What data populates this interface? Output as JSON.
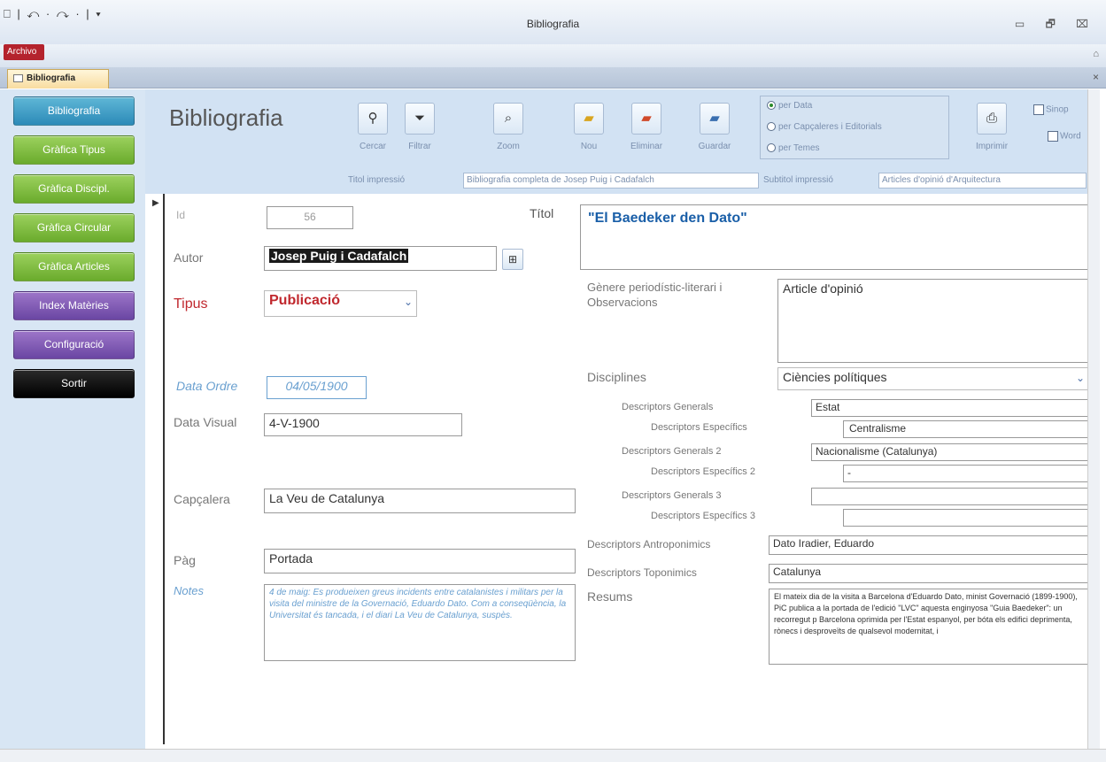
{
  "window": {
    "title": "Bibliografia",
    "qat": "⎕ | ↶ · ↷ · | ▾",
    "controls": "▭ 🗗 ⌧"
  },
  "ribbon": {
    "file_tab": "Archivo",
    "minimize": "⌂"
  },
  "doc_tab": {
    "label": "Bibliografia",
    "close": "×"
  },
  "nav": {
    "items": [
      {
        "label": "Bibliografia"
      },
      {
        "label": "Gràfica Tipus"
      },
      {
        "label": "Gràfica Discipl."
      },
      {
        "label": "Gràfica Circular"
      },
      {
        "label": "Gràfica Articles"
      },
      {
        "label": "Index Matèries"
      },
      {
        "label": "Configuració"
      },
      {
        "label": "Sortir"
      }
    ]
  },
  "header": {
    "title": "Bibliografia",
    "buttons": {
      "cercar": "Cercar",
      "filtrar": "Filtrar",
      "zoom": "Zoom",
      "nou": "Nou",
      "eliminar": "Eliminar",
      "guardar": "Guardar",
      "imprimir": "Imprimir"
    },
    "radios": {
      "per_data": "per Data",
      "per_capcaleres": "per Capçaleres i Editorials",
      "per_temes": "per Temes"
    },
    "checks": {
      "sinopsi": "Sinop",
      "word": "Word"
    },
    "titol_imp_label": "Titol impressió",
    "titol_imp_value": "Bibliografia completa de Josep Puig i Cadafalch",
    "subtitol_imp_label": "Subtitol impressió",
    "subtitol_imp_value": "Articles d'opinió d'Arquitectura"
  },
  "record": {
    "id_label": "Id",
    "id_value": "56",
    "titol_label": "Títol",
    "titol_value": "\"El Baedeker den Dato\"",
    "autor_label": "Autor",
    "autor_value": "Josep Puig i Cadafalch",
    "tipus_label": "Tipus",
    "tipus_value": "Publicació",
    "genere_label": "Gènere periodístic-literari i Observacions",
    "genere_value": "Article d'opinió",
    "data_ordre_label": "Data Ordre",
    "data_ordre_value": "04/05/1900",
    "data_visual_label": "Data Visual",
    "data_visual_value": "4-V-1900",
    "disciplines_label": "Disciplines",
    "disciplines_value": "Ciències polítiques",
    "desc_gen_label": "Descriptors Generals",
    "desc_gen_value": "Estat",
    "desc_esp_label": "Descriptors Específics",
    "desc_esp_value": "Centralisme",
    "desc_gen2_label": "Descriptors Generals 2",
    "desc_gen2_value": "Nacionalisme  (Catalunya)",
    "desc_esp2_label": "Descriptors Específics 2",
    "desc_esp2_value": "-",
    "desc_gen3_label": "Descriptors Generals 3",
    "desc_gen3_value": "",
    "desc_esp3_label": "Descriptors Específics 3",
    "desc_esp3_value": "",
    "capcalera_label": "Capçalera",
    "capcalera_value": "La Veu de Catalunya",
    "antro_label": "Descriptors Antroponimics",
    "antro_value": "Dato Iradier, Eduardo",
    "topo_label": "Descriptors Toponimics",
    "topo_value": "Catalunya",
    "pag_label": "Pàg",
    "pag_value": "Portada",
    "notes_label": "Notes",
    "notes_value": "4 de maig: Es produeixen greus incidents entre catalanistes i militars per la visita del ministre de la Governació, Eduardo Dato. Com a conseqüència, la Universitat és tancada, i el diari La Veu de Catalunya, suspès.",
    "resums_label": "Resums",
    "resums_value": "El mateix dia de la visita a Barcelona d'Eduardo Dato, minist Governació (1899-1900), PiC publica a la portada de l'edició \"LVC\" aquesta enginyosa \"Guia Baedeker\": un recorregut p Barcelona oprimida per l'Estat espanyol, per bóta els edifici deprimenta, rònecs i desproveïts de qualsevol modernitat, i"
  },
  "colors": {
    "nav_bg": "#d8e6f4",
    "header_bg": "#d2e2f3",
    "tipus_red": "#c0282e",
    "titol_blue": "#1a5fa8"
  }
}
